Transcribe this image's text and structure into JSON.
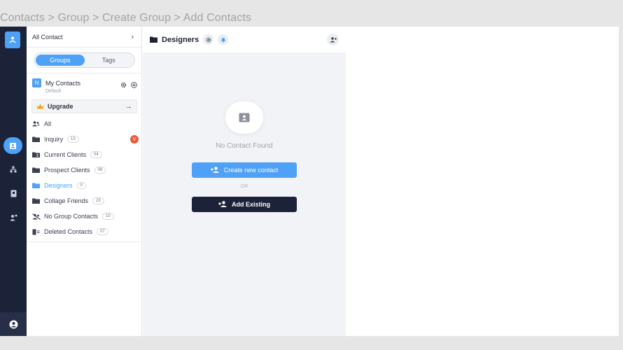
{
  "breadcrumb": "Contacts > Group > Create Group > Add Contacts",
  "rail": {
    "icons": [
      "user-network-icon",
      "contact-card-icon",
      "sitemap-icon",
      "book-icon",
      "user-bell-icon",
      "account-circle-icon"
    ]
  },
  "sidebar": {
    "header": "All Contact",
    "header_chevron": "›",
    "tabs": [
      {
        "label": "Groups",
        "active": true
      },
      {
        "label": "Tags",
        "active": false
      }
    ],
    "my_contacts": {
      "badge": "N",
      "title": "My Contacts",
      "subtitle": "Default"
    },
    "upgrade": {
      "label": "Upgrade",
      "arrow": "→"
    },
    "groups": [
      {
        "label": "All",
        "count": "",
        "icon": "users-icon"
      },
      {
        "label": "Inquiry",
        "count": "13",
        "icon": "folder-icon",
        "badge": "V"
      },
      {
        "label": "Current Clients",
        "count": "04",
        "icon": "folder-user-icon"
      },
      {
        "label": "Prospect Clients",
        "count": "08",
        "icon": "folder-icon"
      },
      {
        "label": "Designers",
        "count": "0",
        "icon": "folder-icon",
        "active": true
      },
      {
        "label": "Collage Friends",
        "count": "23",
        "icon": "folder-icon"
      },
      {
        "label": "No Group Contacts",
        "count": "10",
        "icon": "users-slash-icon"
      },
      {
        "label": "Deleted Contacts",
        "count": "07",
        "icon": "trash-icon"
      }
    ]
  },
  "main": {
    "title": "Designers",
    "empty_text": "No Contact Found",
    "create_label": "Create new contact",
    "or_label": "OR",
    "existing_label": "Add Existing"
  },
  "colors": {
    "accent": "#4ea1f7",
    "dark": "#1c2238",
    "danger": "#e85a3c"
  }
}
